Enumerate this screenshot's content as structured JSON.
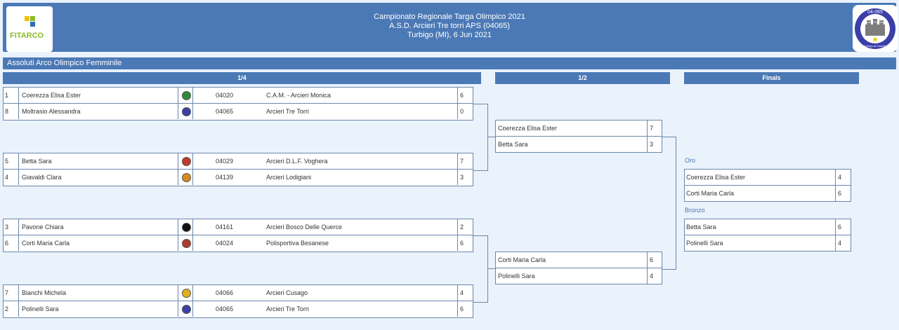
{
  "header": {
    "line1": "Campionato Regionale Targa Olimpico 2021",
    "line2": "A.S.D. Arcieri Tre torri APS (04065)",
    "line3": "Turbigo (MI), 6 Jun 2021",
    "left_logo": "FITARCO",
    "right_logo_top": "04-065",
    "right_logo_ring": "Arcieri Tre Torri",
    "right_logo_bottom": "Turbigo al Castello"
  },
  "section_title": "Assoluti Arco Olimpico Femminile",
  "columns": {
    "quarter": "1/4",
    "semi": "1/2",
    "finals": "Finals"
  },
  "quarters": [
    {
      "rows": [
        {
          "seed": "1",
          "name": "Coerezza Elisa Ester",
          "flag": "cam-monica-logo",
          "flag_color": "#2e8b3a",
          "code": "04020",
          "club": "C.A.M. - Arcieri Monica",
          "score": "6"
        },
        {
          "seed": "8",
          "name": "Moltrasio Alessandra",
          "flag": "tre-torri-logo",
          "flag_color": "#3b3fa8",
          "code": "04065",
          "club": "Arcieri Tre Torri",
          "score": "0"
        }
      ]
    },
    {
      "rows": [
        {
          "seed": "5",
          "name": "Betta Sara",
          "flag": "dlf-voghera-logo",
          "flag_color": "#c0392b",
          "code": "04029",
          "club": "Arcieri D.L.F. Voghera",
          "score": "7"
        },
        {
          "seed": "4",
          "name": "Giavaldi Clara",
          "flag": "lodigiani-logo",
          "flag_color": "#d98a1f",
          "code": "04139",
          "club": "Arcieri Lodigiani",
          "score": "3"
        }
      ]
    },
    {
      "rows": [
        {
          "seed": "3",
          "name": "Pavone Chiara",
          "flag": "bosco-querce-logo",
          "flag_color": "#111111",
          "code": "04161",
          "club": "Arcieri Bosco Delle Querce",
          "score": "2"
        },
        {
          "seed": "6",
          "name": "Corti Maria Carla",
          "flag": "besanese-logo",
          "flag_color": "#b03a2e",
          "code": "04024",
          "club": "Polisportiva Besanese",
          "score": "6"
        }
      ]
    },
    {
      "rows": [
        {
          "seed": "7",
          "name": "Bianchi Michela",
          "flag": "cusago-logo",
          "flag_color": "#e0b020",
          "code": "04066",
          "club": "Arcieri Cusago",
          "score": "4"
        },
        {
          "seed": "2",
          "name": "Polinelli Sara",
          "flag": "tre-torri-logo",
          "flag_color": "#3b3fa8",
          "code": "04065",
          "club": "Arcieri Tre Torri",
          "score": "6"
        }
      ]
    }
  ],
  "semis": [
    {
      "rows": [
        {
          "name": "Coerezza Elisa Ester",
          "score": "7"
        },
        {
          "name": "Betta Sara",
          "score": "3"
        }
      ]
    },
    {
      "rows": [
        {
          "name": "Corti Maria Carla",
          "score": "6"
        },
        {
          "name": "Polinelli Sara",
          "score": "4"
        }
      ]
    }
  ],
  "finals": {
    "gold_label": "Oro",
    "gold": {
      "rows": [
        {
          "name": "Coerezza Elisa Ester",
          "score": "4"
        },
        {
          "name": "Corti Maria Carla",
          "score": "6"
        }
      ]
    },
    "bronze_label": "Bronzo",
    "bronze": {
      "rows": [
        {
          "name": "Betta Sara",
          "score": "6"
        },
        {
          "name": "Polinelli Sara",
          "score": "4"
        }
      ]
    }
  }
}
